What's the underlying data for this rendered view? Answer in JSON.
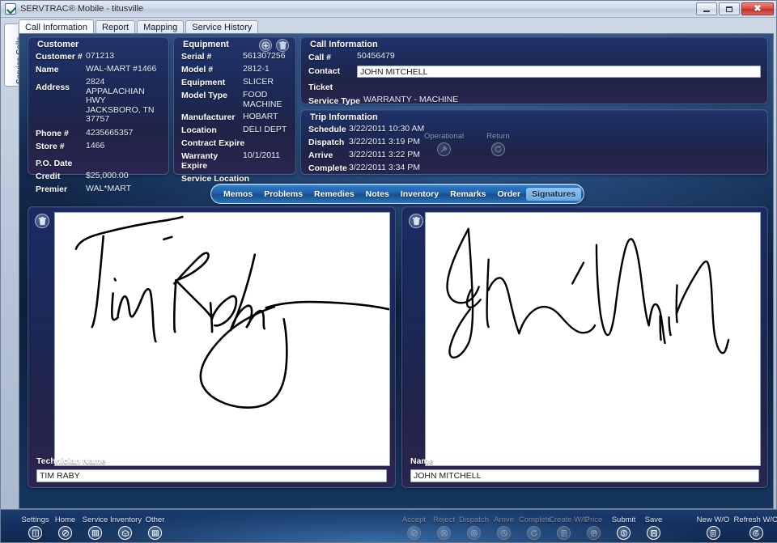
{
  "window": {
    "title": "SERVTRAC® Mobile - titusville",
    "app_icon": "checkmark-document-icon",
    "controls": {
      "minimize": "Minimize",
      "maximize": "Maximize",
      "close": "Close"
    }
  },
  "vertical_tab": {
    "label": "Service Calls"
  },
  "tabs": [
    {
      "label": "Call Information",
      "active": true
    },
    {
      "label": "Report",
      "active": false
    },
    {
      "label": "Mapping",
      "active": false
    },
    {
      "label": "Service History",
      "active": false
    }
  ],
  "customer": {
    "title": "Customer",
    "fields": [
      {
        "label": "Customer #",
        "value": "071213"
      },
      {
        "label": "Name",
        "value": "WAL-MART #1466"
      },
      {
        "label": "Address",
        "value": "2824 APPALACHIAN HWY\nJACKSBORO, TN 37757"
      },
      {
        "label": "Phone #",
        "value": "4235665357"
      },
      {
        "label": "Store #",
        "value": "1466"
      },
      {
        "label": "P.O. Date",
        "value": ""
      },
      {
        "label": "Credit",
        "value": "$25,000.00"
      },
      {
        "label": "Premier",
        "value": "WAL*MART"
      }
    ]
  },
  "equipment": {
    "title": "Equipment",
    "add_icon": "plus-circle-icon",
    "delete_icon": "trash-icon",
    "fields": [
      {
        "label": "Serial #",
        "value": "561307256"
      },
      {
        "label": "Model #",
        "value": "2812-1"
      },
      {
        "label": "Equipment",
        "value": "SLICER"
      },
      {
        "label": "Model Type",
        "value": "FOOD MACHINE"
      },
      {
        "label": "Manufacturer",
        "value": "HOBART"
      },
      {
        "label": "Location",
        "value": "DELI DEPT"
      },
      {
        "label": "Contract Expire",
        "value": ""
      },
      {
        "label": "Warranty Expire",
        "value": "10/1/2011"
      },
      {
        "label": "Service Location",
        "value": ""
      }
    ]
  },
  "call_information": {
    "title": "Call Information",
    "call_number_label": "Call #",
    "call_number": "50456479",
    "contact_label": "Contact",
    "contact_value": "JOHN MITCHELL",
    "contact_placeholder": "",
    "ticket_label": "Ticket",
    "ticket_value": "",
    "service_type_label": "Service Type",
    "service_type_value": "WARRANTY - MACHINE"
  },
  "trip_information": {
    "title": "Trip Information",
    "rows": [
      {
        "label": "Schedule",
        "value": "3/22/2011 10:30 AM"
      },
      {
        "label": "Dispatch",
        "value": "3/22/2011 3:19 PM"
      },
      {
        "label": "Arrive",
        "value": "3/22/2011 3:22 PM"
      },
      {
        "label": "Complete",
        "value": "3/22/2011 3:34 PM"
      }
    ],
    "icons": [
      {
        "label": "Operational",
        "icon": "wrench-circle-icon"
      },
      {
        "label": "Return",
        "icon": "return-circle-icon"
      }
    ]
  },
  "section_tabs": [
    {
      "label": "Memos",
      "active": false
    },
    {
      "label": "Problems",
      "active": false
    },
    {
      "label": "Remedies",
      "active": false
    },
    {
      "label": "Notes",
      "active": false
    },
    {
      "label": "Inventory",
      "active": false
    },
    {
      "label": "Remarks",
      "active": false
    },
    {
      "label": "Order",
      "active": false
    },
    {
      "label": "Signatures",
      "active": true
    }
  ],
  "signatures": {
    "left": {
      "delete_icon": "trash-icon",
      "name_label": "Technician Name",
      "name_value": "TIM RABY",
      "name_placeholder": ""
    },
    "right": {
      "delete_icon": "trash-icon",
      "name_label": "Name",
      "name_value": "JOHN MITCHELL",
      "name_placeholder": ""
    }
  },
  "toolbar": {
    "left_group": [
      {
        "label": "Settings",
        "icon": "settings-icon",
        "enabled": true
      },
      {
        "label": "Home",
        "icon": "home-icon",
        "enabled": true
      },
      {
        "label": "Service",
        "icon": "service-icon",
        "enabled": true
      },
      {
        "label": "Inventory",
        "icon": "inventory-icon",
        "enabled": true
      },
      {
        "label": "Other",
        "icon": "other-icon",
        "enabled": true
      }
    ],
    "action_group": [
      {
        "label": "Accept",
        "icon": "check-icon",
        "enabled": false
      },
      {
        "label": "Reject",
        "icon": "reject-icon",
        "enabled": false
      },
      {
        "label": "Dispatch",
        "icon": "dispatch-icon",
        "enabled": false
      },
      {
        "label": "Arrive",
        "icon": "arrive-icon",
        "enabled": false
      },
      {
        "label": "Complete",
        "icon": "complete-icon",
        "enabled": false
      },
      {
        "label": "Create W/O",
        "icon": "create-wo-icon",
        "enabled": false
      },
      {
        "label": "Price",
        "icon": "price-icon",
        "enabled": false
      },
      {
        "label": "Submit",
        "icon": "submit-icon",
        "enabled": true
      },
      {
        "label": "Save",
        "icon": "save-icon",
        "enabled": true
      }
    ],
    "right_group": [
      {
        "label": "New W/O",
        "icon": "new-wo-icon",
        "enabled": true
      },
      {
        "label": "Refresh W/O",
        "icon": "refresh-wo-icon",
        "enabled": true
      }
    ]
  },
  "colors": {
    "accent_blue": "#2f7fc9",
    "panel_navy": "#1b2a58",
    "surface_navy": "#12294c",
    "active_pill": "#8fc2ef",
    "close_red": "#c12f27"
  }
}
